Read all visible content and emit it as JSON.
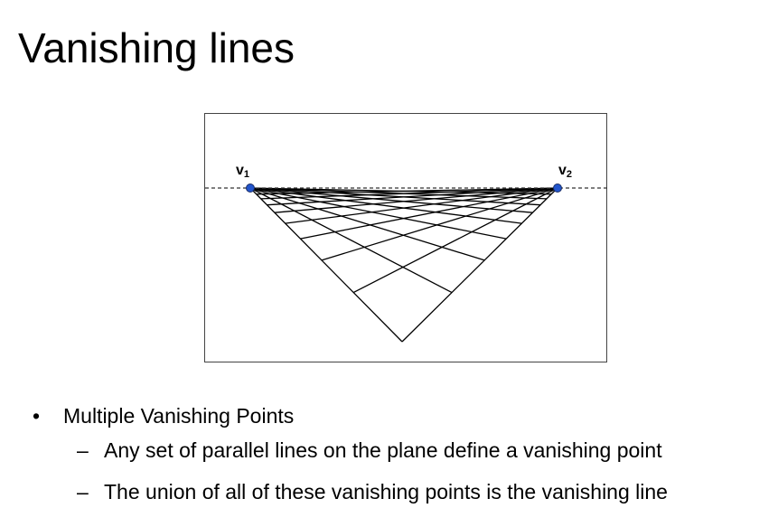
{
  "slide": {
    "title": "Vanishing lines"
  },
  "figure": {
    "label_v1": "v",
    "label_v1_sub": "1",
    "label_v2": "v",
    "label_v2_sub": "2",
    "point_color": "#2255cc",
    "line_color": "#000000",
    "horizon_style": "dashed"
  },
  "bullets": {
    "level1": [
      {
        "marker": "•",
        "text": "Multiple Vanishing Points"
      }
    ],
    "level2": [
      {
        "marker": "–",
        "text": "Any set of parallel lines on the plane define a vanishing point"
      },
      {
        "marker": "–",
        "text": "The union of all of these vanishing points is the vanishing line"
      }
    ]
  }
}
